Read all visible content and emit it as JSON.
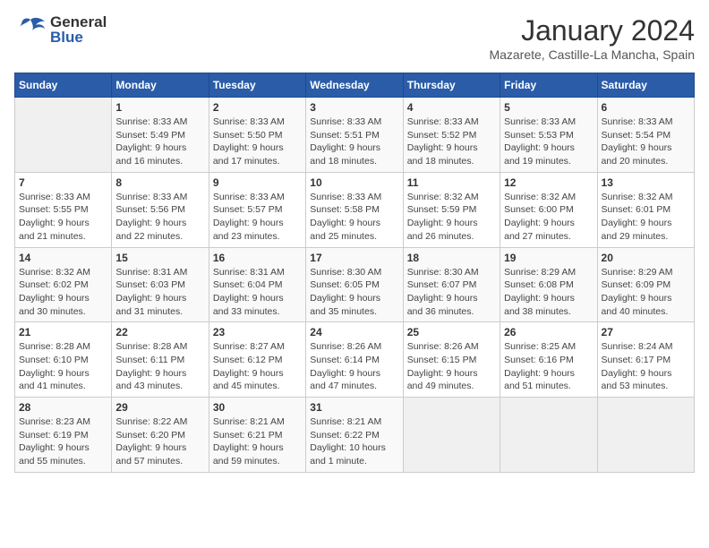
{
  "header": {
    "logo_general": "General",
    "logo_blue": "Blue",
    "title": "January 2024",
    "subtitle": "Mazarete, Castille-La Mancha, Spain"
  },
  "columns": [
    "Sunday",
    "Monday",
    "Tuesday",
    "Wednesday",
    "Thursday",
    "Friday",
    "Saturday"
  ],
  "weeks": [
    [
      {
        "num": "",
        "info": ""
      },
      {
        "num": "1",
        "info": "Sunrise: 8:33 AM\nSunset: 5:49 PM\nDaylight: 9 hours\nand 16 minutes."
      },
      {
        "num": "2",
        "info": "Sunrise: 8:33 AM\nSunset: 5:50 PM\nDaylight: 9 hours\nand 17 minutes."
      },
      {
        "num": "3",
        "info": "Sunrise: 8:33 AM\nSunset: 5:51 PM\nDaylight: 9 hours\nand 18 minutes."
      },
      {
        "num": "4",
        "info": "Sunrise: 8:33 AM\nSunset: 5:52 PM\nDaylight: 9 hours\nand 18 minutes."
      },
      {
        "num": "5",
        "info": "Sunrise: 8:33 AM\nSunset: 5:53 PM\nDaylight: 9 hours\nand 19 minutes."
      },
      {
        "num": "6",
        "info": "Sunrise: 8:33 AM\nSunset: 5:54 PM\nDaylight: 9 hours\nand 20 minutes."
      }
    ],
    [
      {
        "num": "7",
        "info": "Sunrise: 8:33 AM\nSunset: 5:55 PM\nDaylight: 9 hours\nand 21 minutes."
      },
      {
        "num": "8",
        "info": "Sunrise: 8:33 AM\nSunset: 5:56 PM\nDaylight: 9 hours\nand 22 minutes."
      },
      {
        "num": "9",
        "info": "Sunrise: 8:33 AM\nSunset: 5:57 PM\nDaylight: 9 hours\nand 23 minutes."
      },
      {
        "num": "10",
        "info": "Sunrise: 8:33 AM\nSunset: 5:58 PM\nDaylight: 9 hours\nand 25 minutes."
      },
      {
        "num": "11",
        "info": "Sunrise: 8:32 AM\nSunset: 5:59 PM\nDaylight: 9 hours\nand 26 minutes."
      },
      {
        "num": "12",
        "info": "Sunrise: 8:32 AM\nSunset: 6:00 PM\nDaylight: 9 hours\nand 27 minutes."
      },
      {
        "num": "13",
        "info": "Sunrise: 8:32 AM\nSunset: 6:01 PM\nDaylight: 9 hours\nand 29 minutes."
      }
    ],
    [
      {
        "num": "14",
        "info": "Sunrise: 8:32 AM\nSunset: 6:02 PM\nDaylight: 9 hours\nand 30 minutes."
      },
      {
        "num": "15",
        "info": "Sunrise: 8:31 AM\nSunset: 6:03 PM\nDaylight: 9 hours\nand 31 minutes."
      },
      {
        "num": "16",
        "info": "Sunrise: 8:31 AM\nSunset: 6:04 PM\nDaylight: 9 hours\nand 33 minutes."
      },
      {
        "num": "17",
        "info": "Sunrise: 8:30 AM\nSunset: 6:05 PM\nDaylight: 9 hours\nand 35 minutes."
      },
      {
        "num": "18",
        "info": "Sunrise: 8:30 AM\nSunset: 6:07 PM\nDaylight: 9 hours\nand 36 minutes."
      },
      {
        "num": "19",
        "info": "Sunrise: 8:29 AM\nSunset: 6:08 PM\nDaylight: 9 hours\nand 38 minutes."
      },
      {
        "num": "20",
        "info": "Sunrise: 8:29 AM\nSunset: 6:09 PM\nDaylight: 9 hours\nand 40 minutes."
      }
    ],
    [
      {
        "num": "21",
        "info": "Sunrise: 8:28 AM\nSunset: 6:10 PM\nDaylight: 9 hours\nand 41 minutes."
      },
      {
        "num": "22",
        "info": "Sunrise: 8:28 AM\nSunset: 6:11 PM\nDaylight: 9 hours\nand 43 minutes."
      },
      {
        "num": "23",
        "info": "Sunrise: 8:27 AM\nSunset: 6:12 PM\nDaylight: 9 hours\nand 45 minutes."
      },
      {
        "num": "24",
        "info": "Sunrise: 8:26 AM\nSunset: 6:14 PM\nDaylight: 9 hours\nand 47 minutes."
      },
      {
        "num": "25",
        "info": "Sunrise: 8:26 AM\nSunset: 6:15 PM\nDaylight: 9 hours\nand 49 minutes."
      },
      {
        "num": "26",
        "info": "Sunrise: 8:25 AM\nSunset: 6:16 PM\nDaylight: 9 hours\nand 51 minutes."
      },
      {
        "num": "27",
        "info": "Sunrise: 8:24 AM\nSunset: 6:17 PM\nDaylight: 9 hours\nand 53 minutes."
      }
    ],
    [
      {
        "num": "28",
        "info": "Sunrise: 8:23 AM\nSunset: 6:19 PM\nDaylight: 9 hours\nand 55 minutes."
      },
      {
        "num": "29",
        "info": "Sunrise: 8:22 AM\nSunset: 6:20 PM\nDaylight: 9 hours\nand 57 minutes."
      },
      {
        "num": "30",
        "info": "Sunrise: 8:21 AM\nSunset: 6:21 PM\nDaylight: 9 hours\nand 59 minutes."
      },
      {
        "num": "31",
        "info": "Sunrise: 8:21 AM\nSunset: 6:22 PM\nDaylight: 10 hours\nand 1 minute."
      },
      {
        "num": "",
        "info": ""
      },
      {
        "num": "",
        "info": ""
      },
      {
        "num": "",
        "info": ""
      }
    ]
  ]
}
